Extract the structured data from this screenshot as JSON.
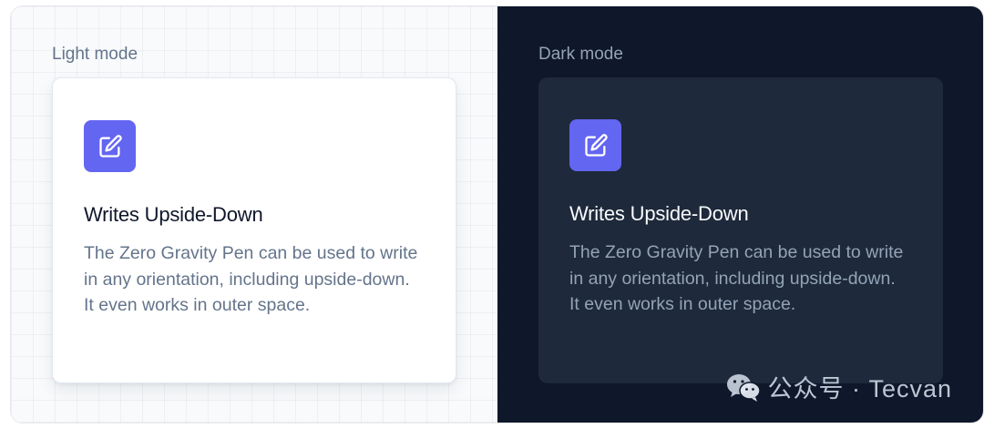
{
  "colors": {
    "accent": "#6366f1",
    "light_bg": "#f8fafc",
    "dark_bg": "#0f172a",
    "dark_card": "#1e293b",
    "light_text_heading": "#0f172a",
    "light_text_body": "#64748b",
    "dark_text_heading": "#f8fafc",
    "dark_text_body": "#94a3b8"
  },
  "light": {
    "label": "Light mode",
    "card": {
      "icon": "pencil-square-icon",
      "title": "Writes Upside-Down",
      "description": "The Zero Gravity Pen can be used to write in any orientation, including upside-down. It even works in outer space."
    }
  },
  "dark": {
    "label": "Dark mode",
    "card": {
      "icon": "pencil-square-icon",
      "title": "Writes Upside-Down",
      "description": "The Zero Gravity Pen can be used to write in any orientation, including upside-down. It even works in outer space."
    }
  },
  "watermark": {
    "text": "公众号 · Tecvan",
    "icon": "wechat-icon"
  }
}
